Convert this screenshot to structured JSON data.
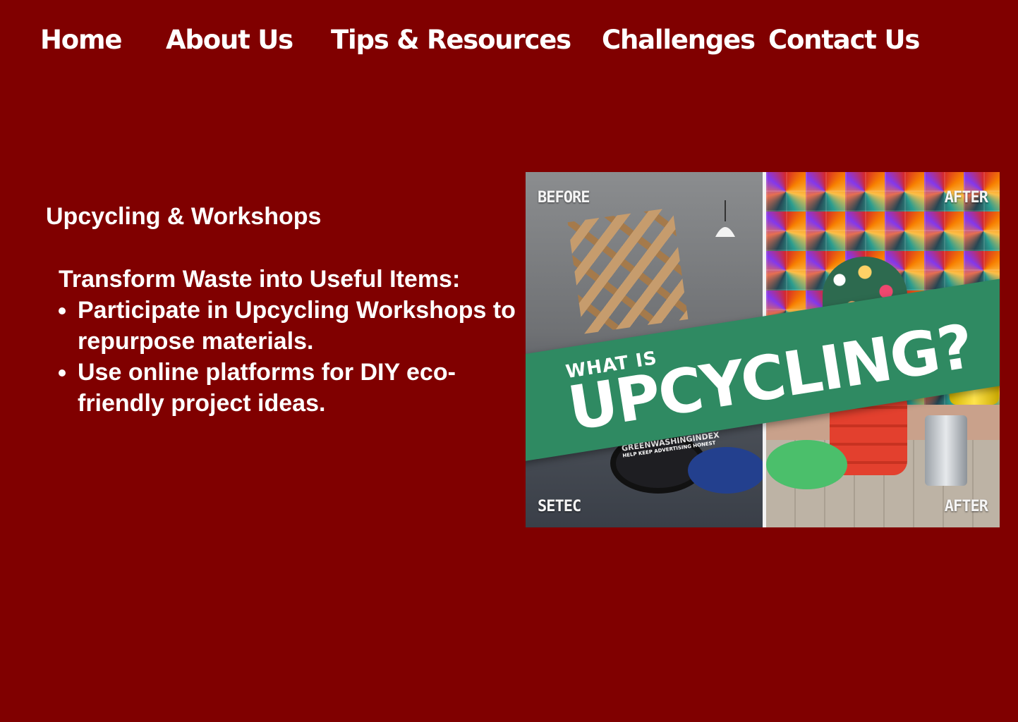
{
  "nav": {
    "home": "Home",
    "about": "About Us",
    "tips": "Tips & Resources",
    "challenges": "Challenges",
    "contact": "Contact Us"
  },
  "content": {
    "section_title": "Upcycling & Workshops",
    "subheading": "Transform Waste into Useful Items:",
    "bullets": [
      "Participate in Upcycling Workshops to repurpose materials.",
      "Use online platforms for DIY eco-friendly project ideas."
    ]
  },
  "image": {
    "label_before_top": "BEFORE",
    "label_after_top": "AFTER",
    "label_before_bottom": "SETEC",
    "label_after_bottom": "AFTER",
    "banner_small": "WHAT IS",
    "banner_big": "UPCYCLING?",
    "sponsor_name": "GREENWASHINGINDEX",
    "sponsor_sub": "HELP KEEP ADVERTISING HONEST"
  },
  "colors": {
    "background": "#800000",
    "text": "#ffffff",
    "banner": "#2f8a62"
  }
}
